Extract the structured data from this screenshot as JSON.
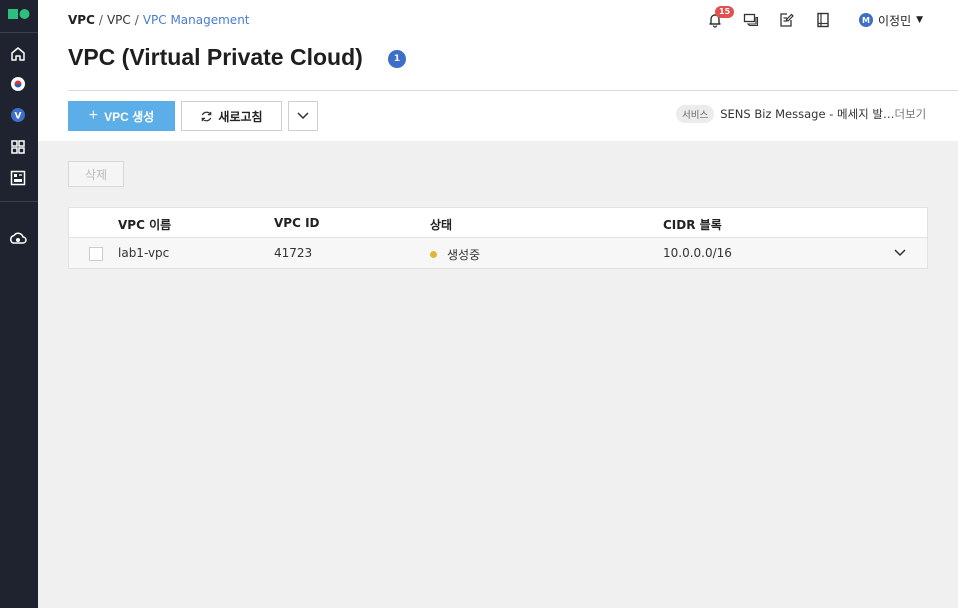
{
  "breadcrumb": {
    "root": "VPC",
    "sep1": "/",
    "mid": "VPC",
    "sep2": "/",
    "current": "VPC Management"
  },
  "header": {
    "notification_count": "15",
    "user_initial": "M",
    "user_name": "이정민"
  },
  "page": {
    "title": "VPC (Virtual Private Cloud)",
    "count": "1"
  },
  "toolbar": {
    "create_label": "VPC 생성",
    "refresh_label": "새로고침",
    "delete_label": "삭제"
  },
  "notice": {
    "tag": "서비스",
    "text": "SENS Biz Message - 메세지 발…",
    "more": "더보기"
  },
  "table": {
    "headers": [
      "VPC 이름",
      "VPC ID",
      "상태",
      "CIDR 블록"
    ],
    "rows": [
      {
        "name": "lab1-vpc",
        "id": "41723",
        "status": "생성중",
        "cidr": "10.0.0.0/16"
      }
    ]
  },
  "colors": {
    "primary": "#5baee8",
    "sidebar": "#1f2330",
    "badge": "#e4504f",
    "status_pending": "#e5b33a",
    "accent_blue": "#3d6ec9"
  },
  "icons": {
    "sidebar": [
      "logo",
      "home-icon",
      "korea-flag-icon",
      "vpc-v-icon",
      "grid-apps-icon",
      "dashboard-icon",
      "cloud-settings-icon"
    ],
    "header": [
      "bell-icon",
      "chat-icon",
      "edit-note-icon",
      "book-icon"
    ]
  }
}
